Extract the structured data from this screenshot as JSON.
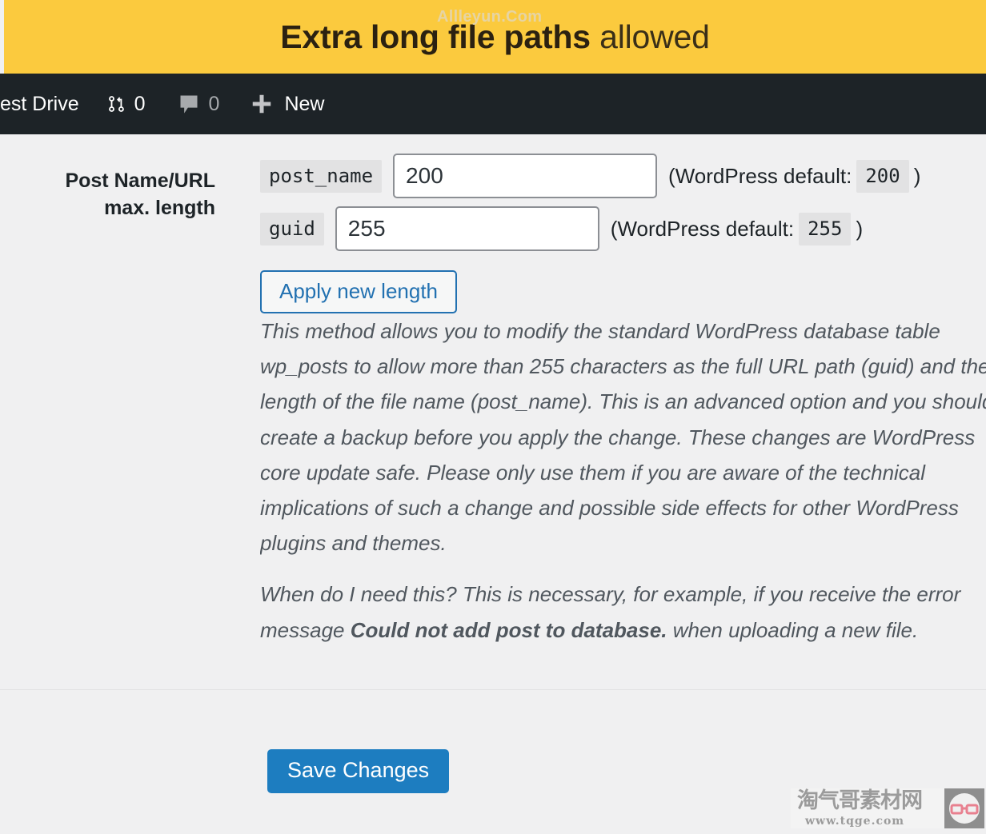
{
  "notice": {
    "title_strong": "Extra long file paths",
    "title_light": " allowed",
    "watermark_top": "Allleyun.Com"
  },
  "admin_bar": {
    "site_name": "est Drive",
    "updates_icon": "updates-icon",
    "updates_count": "0",
    "comments_icon": "comment-bubble-icon",
    "comments_count": "0",
    "new_icon": "plus-icon",
    "new_label": "New"
  },
  "form": {
    "row_label": "Post Name/URL max. length",
    "fields": [
      {
        "code_label": "post_name",
        "value": "200",
        "default_prefix": "(WordPress default:",
        "default_value": "200",
        "default_suffix": ")"
      },
      {
        "code_label": "guid",
        "value": "255",
        "default_prefix": "(WordPress default:",
        "default_value": "255",
        "default_suffix": ")"
      }
    ],
    "apply_button": "Apply new length",
    "description": [
      "This method allows you to modify the standard WordPress database table wp_posts to allow more than 255 characters as the full URL path (guid) and the length of the file name (post_name). This is an advanced option and you should create a backup before you apply the change. These changes are WordPress core update safe. Please only use them if you are aware of the technical implications of such a change and possible side effects for other WordPress plugins and themes.",
      "When do I need this? This is necessary, for example, if you receive the error message Could not add post to database. when uploading a new file."
    ],
    "description_lines": [
      "This method allows you to modify the standard WordPress database table",
      "wp_posts to allow more than 255 characters as the full URL path (guid) and the",
      "length of the file name (post_name). This is an advanced option and you should",
      "create a backup before you apply the change. These changes are WordPress",
      "core update safe. Please only use them if you are aware of the technical",
      "implications of such a change and possible side effects for other WordPress",
      "plugins and themes."
    ],
    "description2_part1": "When do I need this? This is necessary, for example, if you receive the error",
    "description2_part2": "message ",
    "description2_bold": "Could not add post to database.",
    "description2_part3": " when uploading a new file."
  },
  "submit": {
    "save_label": "Save Changes"
  },
  "watermark_bottom": {
    "cn_text": "淘气哥素材网",
    "url_text": "www.tqge.com",
    "badge_icon": "glasses-icon"
  },
  "colors": {
    "notice_bg": "#fbca3e",
    "admin_bar_bg": "#1d2327",
    "page_bg": "#f0f0f1",
    "primary_button": "#1d7dc0",
    "secondary_button_text": "#2271b1",
    "code_bg": "#e2e2e3"
  }
}
